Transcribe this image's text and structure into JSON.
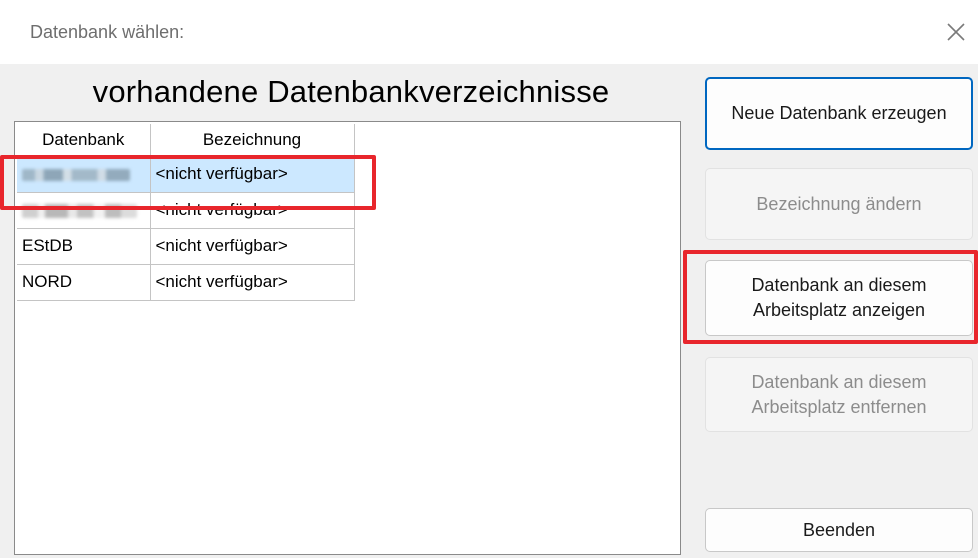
{
  "window": {
    "title": "Datenbank wählen:",
    "close_icon": "close-icon"
  },
  "heading": "vorhandene Datenbankverzeichnisse",
  "table": {
    "columns": [
      "Datenbank",
      "Bezeichnung"
    ],
    "rows": [
      {
        "datenbank": "",
        "bezeichnung": "<nicht verfügbar>",
        "redacted": true,
        "selected": true
      },
      {
        "datenbank": "",
        "bezeichnung": "<nicht verfügbar>",
        "redacted": true,
        "selected": false
      },
      {
        "datenbank": "EStDB",
        "bezeichnung": "<nicht verfügbar>",
        "redacted": false,
        "selected": false
      },
      {
        "datenbank": "NORD",
        "bezeichnung": "<nicht verfügbar>",
        "redacted": false,
        "selected": false
      }
    ]
  },
  "buttons": {
    "neue_datenbank": "Neue Datenbank erzeugen",
    "bezeichnung_aendern": "Bezeichnung ändern",
    "anzeigen_line1": "Datenbank an diesem",
    "anzeigen_line2": "Arbeitsplatz anzeigen",
    "entfernen_line1": "Datenbank an diesem",
    "entfernen_line2": "Arbeitsplatz entfernen",
    "beenden": "Beenden"
  },
  "colors": {
    "highlight": "#e8262c",
    "selection": "#cce8ff",
    "primary_border": "#0067c0"
  }
}
